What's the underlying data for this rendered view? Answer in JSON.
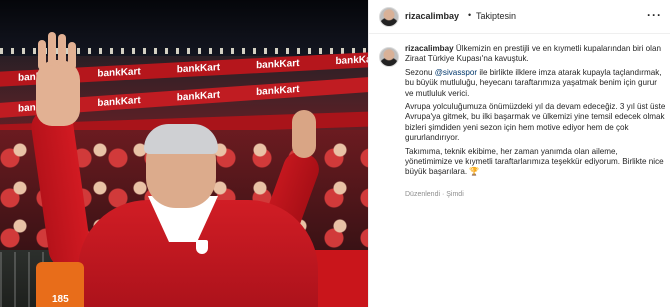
{
  "media": {
    "banner_text": "bankKart",
    "vest_number": "185"
  },
  "header": {
    "username": "rizacalimbay",
    "separator": "•",
    "follow_status": "Takiptesin",
    "more_icon": "more-dots-icon",
    "more_glyph": "···"
  },
  "post": {
    "username": "rizacalimbay",
    "caption_1a": "Ülkemizin en prestijli ve en kıymetli kupalarından biri olan Ziraat Türkiye Kupası'na kavuştuk.",
    "caption_2a": "Sezonu ",
    "mention": "@sivasspor",
    "caption_2b": " ile birlikte ilklere imza atarak kupayla taçlandırmak, bu büyük mutluluğu, heyecanı taraftarımıza yaşatmak benim için gurur ve mutluluk verici.",
    "caption_3": "Avrupa yolculuğumuza önümüzdeki yıl da devam edeceğiz. 3 yıl üst üste Avrupa'ya gitmek, bu ilki başarmak ve ülkemizi yine temsil edecek olmak bizleri şimdiden yeni sezon için hem motive ediyor hem de çok gururlandırıyor.",
    "caption_4": "Takımıma, teknik ekibime, her zaman yanımda olan aileme, yönetimimize ve kıymetli taraftarlarımıza teşekkür ediyorum. Birlikte nice büyük başarılara. 🏆",
    "meta": "Düzenlendi · Şimdi"
  }
}
